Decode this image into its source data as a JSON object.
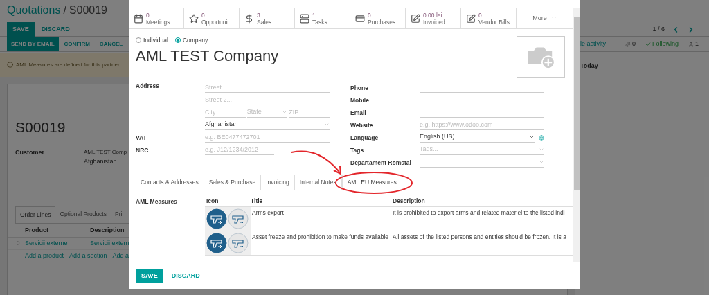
{
  "page": {
    "breadcrumb_link": "Quotations",
    "breadcrumb_separator": "/",
    "breadcrumb_current": "S00019",
    "edit_buttons": [
      {
        "label": "SAVE",
        "primary": true
      },
      {
        "label": "DISCARD",
        "primary": false
      }
    ],
    "pager": "1 / 6",
    "status_buttons": [
      {
        "label": "SEND BY EMAIL",
        "primary": true
      },
      {
        "label": "CONFIRM",
        "primary": false
      },
      {
        "label": "CANCEL",
        "primary": false
      }
    ],
    "alert": "AML Measures are defined for this partner",
    "chatter": {
      "schedule": "le activity",
      "attachments": "0",
      "follow": "Following",
      "followers": "1",
      "date_separator": "Today"
    },
    "sheet": {
      "name": "S00019",
      "customer_label": "Customer",
      "customer": "AML TEST Comp",
      "customer_country": "Afghanistan",
      "tabs": [
        {
          "label": "Order Lines",
          "selected": true
        },
        {
          "label": "Optional Products",
          "selected": false
        },
        {
          "label": "Pri",
          "selected": false
        }
      ],
      "columns": [
        "Product",
        "Description"
      ],
      "rows": [
        [
          "Servicii externe",
          "Servicii extern"
        ]
      ],
      "add_links": [
        "Add a product",
        "Add a section",
        "Add a"
      ]
    }
  },
  "dialog": {
    "stat_buttons": [
      {
        "value": "0",
        "label": "Meetings"
      },
      {
        "value": "0",
        "label": "Opportunit..."
      },
      {
        "value": "3",
        "label": "Sales"
      },
      {
        "value": "1",
        "label": "Tasks"
      },
      {
        "value": "0",
        "label": "Purchases"
      },
      {
        "value": "0.00 lei",
        "label": "Invoiced"
      },
      {
        "value": "0",
        "label": "Vendor Bills"
      }
    ],
    "more": "More",
    "company_type": [
      {
        "label": "Individual",
        "selected": false
      },
      {
        "label": "Company",
        "selected": true
      }
    ],
    "name": "AML TEST Company",
    "address": {
      "label": "Address",
      "lines": [
        [
          {
            "kind": "text",
            "placeholder": "Street..."
          }
        ],
        [
          {
            "kind": "text",
            "placeholder": "Street 2..."
          }
        ],
        [
          {
            "kind": "text",
            "placeholder": "City"
          },
          {
            "kind": "select",
            "placeholder": "State"
          },
          {
            "kind": "text",
            "placeholder": "ZIP"
          }
        ],
        [
          {
            "kind": "select",
            "value": "Afghanistan"
          }
        ]
      ]
    },
    "left_fields": [
      {
        "label": "VAT",
        "kind": "text",
        "placeholder": "e.g. BE0477472701"
      },
      {
        "label": "NRC",
        "kind": "short",
        "placeholder": "e.g. J12/1234/2012"
      }
    ],
    "right_fields": [
      {
        "label": "Phone",
        "kind": "text"
      },
      {
        "label": "Mobile",
        "kind": "text"
      },
      {
        "label": "Email",
        "kind": "text"
      },
      {
        "label": "Website",
        "kind": "text",
        "placeholder": "e.g. https://www.odoo.com"
      },
      {
        "label": "Language",
        "kind": "language",
        "value": "English (US)"
      },
      {
        "label": "Tags",
        "kind": "select",
        "placeholder": "Tags..."
      },
      {
        "label": "Departament Romstal",
        "kind": "select"
      }
    ],
    "tabs": [
      {
        "label": "Contacts & Addresses",
        "selected": false
      },
      {
        "label": "Sales & Purchase",
        "selected": false
      },
      {
        "label": "Invoicing",
        "selected": false
      },
      {
        "label": "Internal Notes",
        "selected": false
      },
      {
        "label": "AML EU Measures",
        "selected": true
      }
    ],
    "aml": {
      "label": "AML Measures",
      "columns": [
        "Icon",
        "Title",
        "Description"
      ],
      "rows": [
        {
          "title": "Arms export",
          "description": "It is prohibited to export arms and related materiel to the listed indi"
        },
        {
          "title": "Asset freeze and prohibition to make funds available",
          "description": "All assets of the listed persons and entities should be frozen. It is a"
        }
      ]
    },
    "footer_buttons": [
      {
        "label": "SAVE",
        "primary": true
      },
      {
        "label": "DISCARD",
        "primary": false
      }
    ]
  }
}
